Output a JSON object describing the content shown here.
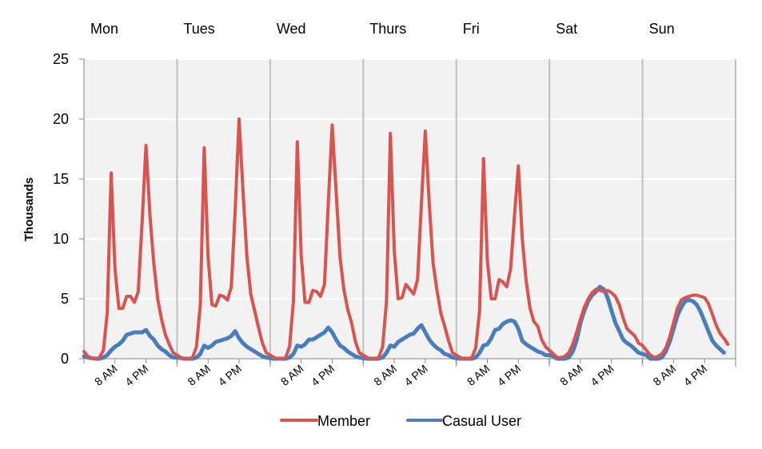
{
  "chart_data": {
    "type": "line",
    "title": "",
    "xlabel": "",
    "ylabel": "Thousands",
    "ylim": [
      0,
      25
    ],
    "yticks": [
      0,
      5,
      10,
      15,
      20,
      25
    ],
    "grid": true,
    "legend_position": "bottom",
    "days": [
      "Mon",
      "Tues",
      "Wed",
      "Thurs",
      "Fri",
      "Sat",
      "Sun"
    ],
    "hour_tick_labels": [
      "8 AM",
      "4 PM"
    ],
    "hours_per_day": 24,
    "colors": {
      "Member": "#d9534f",
      "Casual User": "#4a7ebb",
      "plot_bg": "#f2f2f2",
      "divider": "#bfbfbf"
    },
    "series": [
      {
        "name": "Member",
        "values": [
          0.6,
          0.2,
          0.05,
          0.0,
          0.1,
          0.7,
          3.8,
          15.5,
          7.5,
          4.2,
          4.2,
          5.2,
          5.2,
          4.7,
          5.6,
          11.5,
          17.8,
          12.0,
          8.0,
          5.0,
          3.3,
          2.0,
          1.2,
          0.5,
          0.3,
          0.1,
          0.0,
          0.0,
          0.1,
          1.0,
          4.5,
          17.6,
          8.5,
          4.5,
          4.4,
          5.3,
          5.2,
          4.9,
          6.0,
          12.5,
          20.0,
          14.0,
          8.5,
          5.4,
          4.0,
          2.6,
          1.3,
          0.5,
          0.3,
          0.1,
          0.0,
          0.0,
          0.1,
          1.0,
          4.8,
          18.1,
          8.6,
          4.7,
          4.7,
          5.7,
          5.6,
          5.2,
          6.2,
          13.0,
          19.5,
          14.0,
          8.5,
          5.8,
          4.1,
          3.0,
          1.4,
          0.5,
          0.3,
          0.1,
          0.0,
          0.0,
          0.1,
          1.0,
          4.8,
          18.8,
          9.0,
          5.0,
          5.1,
          6.2,
          5.8,
          5.4,
          6.6,
          13.0,
          19.0,
          13.0,
          8.0,
          5.7,
          3.8,
          2.7,
          1.5,
          0.5,
          0.3,
          0.1,
          0.0,
          0.0,
          0.1,
          0.9,
          4.0,
          16.7,
          8.2,
          5.0,
          5.0,
          6.6,
          6.4,
          6.0,
          7.5,
          12.0,
          16.1,
          10.0,
          6.5,
          4.2,
          3.1,
          2.7,
          1.6,
          1.0,
          0.7,
          0.4,
          0.1,
          0.1,
          0.2,
          0.5,
          1.2,
          2.2,
          3.3,
          4.3,
          5.0,
          5.5,
          5.8,
          5.7,
          5.6,
          5.7,
          5.5,
          5.2,
          4.5,
          3.4,
          2.5,
          2.2,
          1.9,
          1.3,
          1.1,
          0.7,
          0.3,
          0.1,
          0.2,
          0.4,
          0.9,
          1.8,
          3.0,
          4.2,
          4.9,
          5.1,
          5.2,
          5.3,
          5.3,
          5.2,
          5.1,
          4.6,
          3.7,
          2.8,
          2.1,
          1.7,
          1.2
        ]
      },
      {
        "name": "Casual User",
        "values": [
          0.2,
          0.1,
          0.05,
          0.0,
          0.0,
          0.1,
          0.3,
          0.7,
          1.0,
          1.2,
          1.5,
          2.0,
          2.1,
          2.2,
          2.2,
          2.2,
          2.4,
          1.9,
          1.6,
          1.1,
          0.8,
          0.6,
          0.3,
          0.1,
          0.1,
          0.05,
          0.0,
          0.0,
          0.0,
          0.1,
          0.4,
          1.1,
          0.9,
          1.1,
          1.4,
          1.5,
          1.6,
          1.7,
          1.9,
          2.3,
          1.7,
          1.3,
          1.0,
          0.8,
          0.6,
          0.4,
          0.2,
          0.1,
          0.05,
          0.0,
          0.0,
          0.0,
          0.0,
          0.1,
          0.4,
          1.1,
          1.0,
          1.2,
          1.6,
          1.6,
          1.8,
          2.0,
          2.2,
          2.6,
          2.2,
          1.6,
          1.1,
          0.9,
          0.6,
          0.4,
          0.2,
          0.1,
          0.05,
          0.0,
          0.0,
          0.0,
          0.0,
          0.1,
          0.5,
          1.1,
          1.0,
          1.4,
          1.6,
          1.8,
          2.0,
          2.1,
          2.5,
          2.8,
          2.2,
          1.6,
          1.2,
          0.9,
          0.7,
          0.4,
          0.3,
          0.1,
          0.05,
          0.0,
          0.0,
          0.0,
          0.0,
          0.1,
          0.5,
          1.1,
          1.2,
          1.7,
          2.4,
          2.5,
          2.9,
          3.1,
          3.2,
          3.1,
          2.5,
          1.5,
          1.2,
          1.0,
          0.8,
          0.6,
          0.5,
          0.3,
          0.3,
          0.2,
          0.0,
          0.0,
          0.0,
          0.1,
          0.6,
          1.5,
          3.0,
          4.0,
          4.8,
          5.3,
          5.6,
          6.0,
          5.8,
          5.1,
          4.0,
          3.0,
          2.3,
          1.6,
          1.3,
          1.1,
          0.8,
          0.5,
          0.4,
          0.3,
          0.0,
          0.0,
          0.0,
          0.1,
          0.6,
          1.4,
          2.5,
          3.6,
          4.3,
          4.8,
          4.9,
          4.8,
          4.5,
          3.9,
          3.1,
          2.3,
          1.5,
          1.1,
          0.8,
          0.5
        ]
      }
    ]
  }
}
